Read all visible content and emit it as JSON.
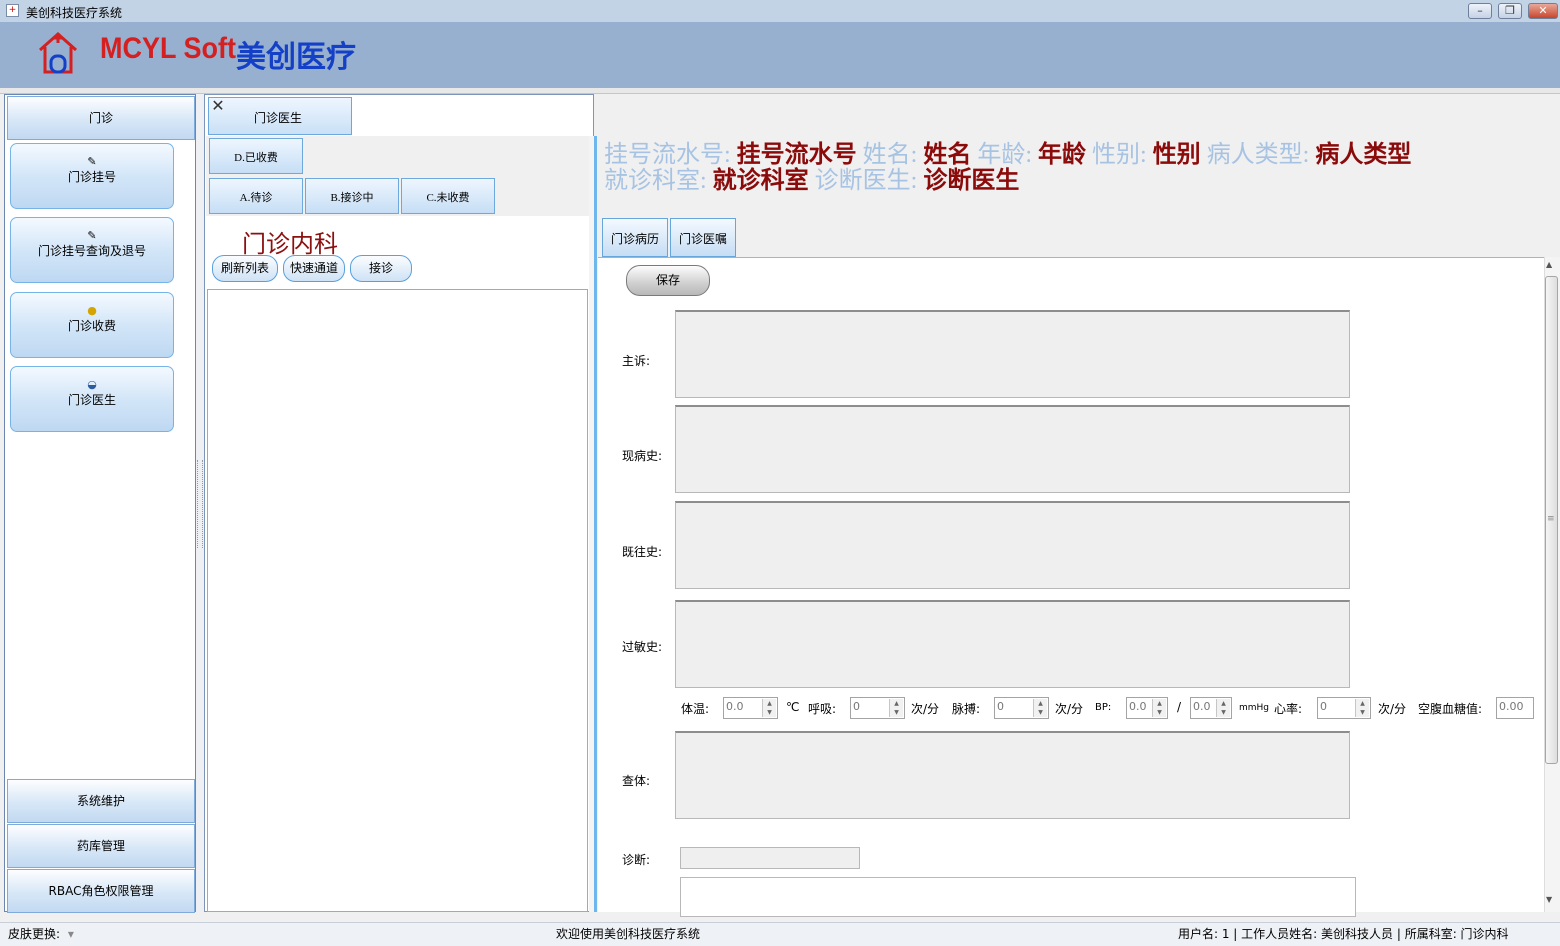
{
  "window": {
    "title": "美创科技医疗系统",
    "minimize_glyph": "–",
    "restore_glyph": "❐",
    "close_glyph": "✕",
    "close_color": "#c8452c"
  },
  "header": {
    "logo_icon": "house-cross-icon",
    "logo_en": "MCYL Soft",
    "logo_cn": "美创医疗",
    "logo_en_color": "#d42020",
    "logo_cn_color": "#1440c8",
    "background": "#97b0cf"
  },
  "nav": {
    "section_title": "门诊",
    "items": [
      {
        "label": "门诊挂号",
        "icon": "registration-icon"
      },
      {
        "label": "门诊挂号查询及退号",
        "icon": "registration-query-icon"
      },
      {
        "label": "门诊收费",
        "icon": "coins-icon"
      },
      {
        "label": "门诊医生",
        "icon": "doctor-icon"
      }
    ],
    "bottom_sections": [
      "系统维护",
      "药库管理",
      "RBAC角色权限管理"
    ]
  },
  "doc_tab": {
    "label": "门诊医生",
    "close_glyph": "✕"
  },
  "queue_tabs": {
    "top": "D.已收费",
    "row": [
      "A.待诊",
      "B.接诊中",
      "C.未收费"
    ]
  },
  "department": {
    "title": "门诊内科",
    "buttons": [
      "刷新列表",
      "快速通道",
      "接诊"
    ]
  },
  "patient_info": {
    "reg_no_label": "挂号流水号:",
    "reg_no": "挂号流水号",
    "name_label": "姓名:",
    "name": "姓名",
    "age_label": "年龄:",
    "age": "年龄",
    "gender_label": "性别:",
    "gender": "性别",
    "type_label": "病人类型:",
    "type": "病人类型",
    "room_label": "就诊科室:",
    "room": "就诊科室",
    "doctor_label": "诊断医生:",
    "doctor": "诊断医生",
    "label_color": "#a7c3e3",
    "value_color": "#8b0a0a"
  },
  "record_tabs": [
    "门诊病历",
    "门诊医嘱"
  ],
  "record": {
    "save_label": "保存",
    "fields": [
      "主诉:",
      "现病史:",
      "既往史:",
      "过敏史:",
      "查体:"
    ],
    "diagnosis_label": "诊断:"
  },
  "vitals": {
    "temp_label": "体温:",
    "temp_value": "0.0",
    "temp_unit": "℃",
    "resp_label": "呼吸:",
    "resp_value": "0",
    "resp_unit": "次/分",
    "pulse_label": "脉搏:",
    "pulse_value": "0",
    "pulse_unit": "次/分",
    "bp_label": "BP:",
    "bp_sys": "0.0",
    "bp_sep": "/",
    "bp_dia": "0.0",
    "bp_unit": "mmHg",
    "hr_label": "心率:",
    "hr_value": "0",
    "hr_unit": "次/分",
    "glucose_label": "空腹血糖值:",
    "glucose_value": "0.00"
  },
  "scrollbar": {
    "up_glyph": "▲",
    "down_glyph": "▼",
    "grip_glyph": "≡"
  },
  "status": {
    "skin_label": "皮肤更换:",
    "skin_dropdown_glyph": "▾",
    "welcome": "欢迎使用美创科技医疗系统",
    "user": "用户名: 1 | 工作人员姓名: 美创科技人员 | 所属科室: 门诊内科"
  }
}
